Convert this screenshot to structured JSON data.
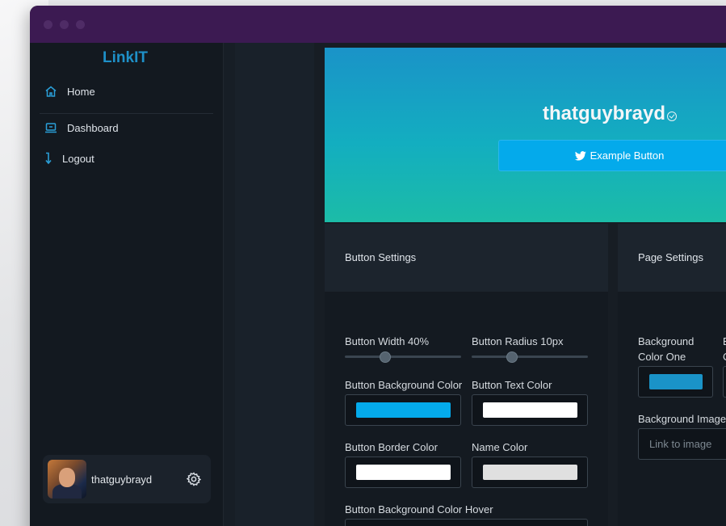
{
  "app": {
    "brand": "LinkIT"
  },
  "sidebar": {
    "items": [
      {
        "label": "Home",
        "icon": "home-icon"
      },
      {
        "label": "Dashboard",
        "icon": "laptop-icon"
      },
      {
        "label": "Logout",
        "icon": "arrow-down-icon"
      }
    ],
    "user": {
      "name": "thatguybrayd",
      "icon": "gear-icon"
    }
  },
  "preview": {
    "username": "thatguybrayd",
    "verified_icon": "verified-check-icon",
    "button_label": "Example Button",
    "button_icon": "twitter-icon"
  },
  "button_settings": {
    "title": "Button Settings",
    "width_label": "Button Width 40%",
    "width_value_percent": 40,
    "radius_label": "Button Radius 10px",
    "radius_value_px": 10,
    "bg_color_label": "Button Background Color",
    "bg_color": "#04aaeb",
    "text_color_label": "Button Text Color",
    "text_color": "#ffffff",
    "border_color_label": "Button Border Color",
    "border_color": "#ffffff",
    "name_color_label": "Name Color",
    "name_color": "#e0e0e0",
    "bg_hover_label": "Button Background Color Hover"
  },
  "page_settings": {
    "title": "Page Settings",
    "bg_color_one_label_line1": "Background",
    "bg_color_one_label_line2": "Color One",
    "bg_color_one": "#1a93c8",
    "bg_color_two_label_line1": "B",
    "bg_color_two_label_line2": "C",
    "bg_image_label": "Background Image",
    "bg_image_placeholder": "Link to image"
  },
  "colors": {
    "titlebar": "#3c1a52",
    "accent": "#1e90c8",
    "sidebar": "#131920"
  }
}
